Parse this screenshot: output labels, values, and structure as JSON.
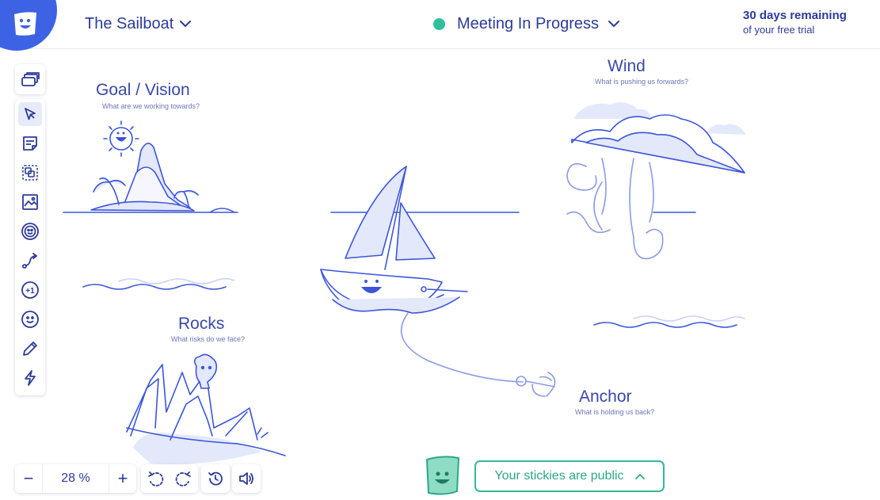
{
  "header": {
    "board_title": "The Sailboat",
    "status": "Meeting In Progress",
    "trial_days": "30 days remaining",
    "trial_note": "of your free trial"
  },
  "canvas": {
    "goal_title": "Goal / Vision",
    "goal_sub": "What are we working towards?",
    "wind_title": "Wind",
    "wind_sub": "What is pushing us forwards?",
    "rocks_title": "Rocks",
    "rocks_sub": "What risks do we face?",
    "anchor_title": "Anchor",
    "anchor_sub": "What is holding us back?"
  },
  "zoom": {
    "minus": "−",
    "value": "28 %",
    "plus": "+"
  },
  "footer": {
    "public_label": "Your stickies are public"
  },
  "colors": {
    "brand_blue": "#3d63e4",
    "status_green": "#2fbf9b",
    "teal": "#2aa888",
    "ink": "#2c3b99"
  },
  "icons": {
    "toolbar": [
      "boards-icon",
      "cursor-icon",
      "sticky-note-icon",
      "group-icon",
      "image-icon",
      "emoji-sticker-icon",
      "connector-icon",
      "plus-one-icon",
      "smiley-icon",
      "pencil-icon",
      "lightning-icon"
    ],
    "controls": [
      "undo-icon",
      "redo-icon",
      "history-icon",
      "sound-icon"
    ]
  }
}
